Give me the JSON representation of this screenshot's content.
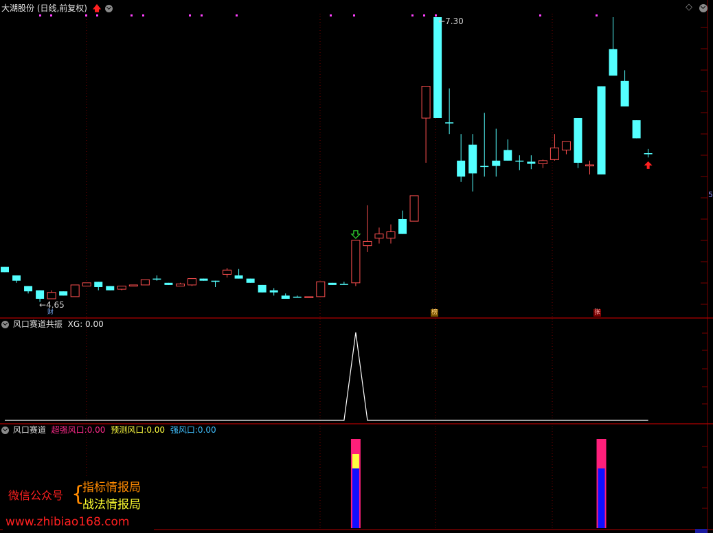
{
  "main": {
    "title": "大湖股份 (日线,前复权)",
    "high_label": "7.30",
    "low_label": "4.65",
    "right_scale_label": "5",
    "markers": {
      "cai": "财",
      "bang": "榜",
      "zhang": "张"
    }
  },
  "xg_panel": {
    "title": "风口赛道共振",
    "value_text": "XG: 0.00"
  },
  "fk_panel": {
    "title": "风口赛道",
    "items": [
      {
        "label": "超强风口:",
        "value": "0.00"
      },
      {
        "label": "预测风口:",
        "value": "0.00"
      },
      {
        "label": "强风口:",
        "value": "0.00"
      }
    ]
  },
  "watermark": {
    "wechat": "微信公众号",
    "line1": "指标情报局",
    "line2": "战法情报局",
    "url": "www.zhibiao168.com"
  },
  "colors": {
    "up": "#ff5050",
    "down": "#54ffff",
    "grid": "#7a0000",
    "xg_line": "#ffffff",
    "super": "#ff1f7a",
    "predict": "#ffff40",
    "strong": "#1010ff"
  },
  "chart_data": [
    {
      "type": "candlestick",
      "x": [
        1,
        2,
        3,
        4,
        5,
        6,
        7,
        8,
        9,
        10,
        11,
        12,
        13,
        14,
        15,
        16,
        17,
        18,
        19,
        20,
        21,
        22,
        23,
        24,
        25,
        26,
        27,
        28,
        29,
        30,
        31,
        32,
        33,
        34,
        35,
        36,
        37,
        38,
        39,
        40,
        41,
        42,
        43,
        44,
        45,
        46,
        47,
        48,
        49,
        50,
        51,
        52,
        53,
        54,
        55,
        56
      ],
      "ohlc": [
        [
          4.95,
          4.95,
          4.9,
          4.9
        ],
        [
          4.87,
          4.87,
          4.8,
          4.82
        ],
        [
          4.77,
          4.77,
          4.7,
          4.72
        ],
        [
          4.73,
          4.73,
          4.62,
          4.65
        ],
        [
          4.65,
          4.73,
          4.65,
          4.71
        ],
        [
          4.72,
          4.72,
          4.68,
          4.68
        ],
        [
          4.67,
          4.78,
          4.67,
          4.78
        ],
        [
          4.77,
          4.8,
          4.77,
          4.8
        ],
        [
          4.81,
          4.81,
          4.73,
          4.76
        ],
        [
          4.77,
          4.77,
          4.73,
          4.73
        ],
        [
          4.74,
          4.77,
          4.73,
          4.77
        ],
        [
          4.77,
          4.78,
          4.77,
          4.78
        ],
        [
          4.78,
          4.83,
          4.78,
          4.83
        ],
        [
          4.84,
          4.87,
          4.82,
          4.84
        ],
        [
          4.8,
          4.8,
          4.78,
          4.78
        ],
        [
          4.77,
          4.8,
          4.77,
          4.79
        ],
        [
          4.78,
          4.84,
          4.77,
          4.84
        ],
        [
          4.84,
          4.84,
          4.82,
          4.82
        ],
        [
          4.82,
          4.82,
          4.76,
          4.81
        ],
        [
          4.88,
          4.94,
          4.85,
          4.92
        ],
        [
          4.87,
          4.93,
          4.84,
          4.84
        ],
        [
          4.84,
          4.84,
          4.8,
          4.8
        ],
        [
          4.78,
          4.78,
          4.71,
          4.71
        ],
        [
          4.73,
          4.75,
          4.68,
          4.71
        ],
        [
          4.68,
          4.7,
          4.65,
          4.65
        ],
        [
          4.67,
          4.68,
          4.66,
          4.66
        ],
        [
          4.66,
          4.67,
          4.66,
          4.67
        ],
        [
          4.67,
          4.81,
          4.67,
          4.81
        ],
        [
          4.8,
          4.8,
          4.78,
          4.78
        ],
        [
          4.79,
          4.81,
          4.79,
          4.79
        ],
        [
          4.8,
          5.2,
          4.77,
          5.2
        ],
        [
          5.15,
          5.53,
          5.09,
          5.19
        ],
        [
          5.22,
          5.32,
          5.17,
          5.26
        ],
        [
          5.22,
          5.35,
          5.17,
          5.28
        ],
        [
          5.4,
          5.48,
          5.26,
          5.26
        ],
        [
          5.38,
          5.62,
          5.38,
          5.62
        ],
        [
          6.35,
          6.6,
          5.93,
          6.65
        ],
        [
          7.3,
          7.3,
          6.35,
          6.35
        ],
        [
          6.31,
          6.63,
          6.2,
          6.31
        ],
        [
          5.95,
          6.2,
          5.75,
          5.8
        ],
        [
          6.1,
          6.2,
          5.66,
          5.83
        ],
        [
          5.9,
          6.4,
          5.8,
          5.9
        ],
        [
          5.95,
          6.25,
          5.8,
          5.9
        ],
        [
          6.05,
          6.15,
          5.95,
          5.95
        ],
        [
          5.95,
          6.0,
          5.86,
          5.95
        ],
        [
          5.94,
          6.0,
          5.87,
          5.92
        ],
        [
          5.92,
          5.96,
          5.88,
          5.95
        ],
        [
          5.96,
          6.2,
          5.95,
          6.07
        ],
        [
          6.05,
          6.11,
          6.01,
          6.13
        ],
        [
          6.35,
          6.35,
          5.88,
          5.93
        ],
        [
          5.9,
          5.95,
          5.82,
          5.91
        ],
        [
          6.65,
          6.65,
          5.82,
          5.82
        ],
        [
          7.0,
          7.3,
          6.75,
          6.75
        ],
        [
          6.7,
          6.8,
          6.46,
          6.46
        ],
        [
          6.33,
          6.33,
          6.16,
          6.16
        ],
        [
          6.02,
          6.06,
          5.98,
          6.02
        ]
      ],
      "last_close_shown": 6.23,
      "annotations": [
        "7.30",
        "4.65"
      ]
    },
    {
      "type": "line",
      "series": [
        {
          "name": "XG",
          "values_note": "0 everywhere, 1 at bar 31"
        }
      ],
      "x": [
        1,
        30,
        31,
        32,
        56
      ],
      "y": [
        0,
        0,
        1,
        0,
        0
      ]
    },
    {
      "type": "bar",
      "series": [
        {
          "name": "超强风口",
          "x": [
            31,
            52
          ],
          "values": [
            1,
            1
          ]
        },
        {
          "name": "预测风口",
          "x": [
            31
          ],
          "values": [
            1
          ]
        },
        {
          "name": "强风口",
          "x": [
            31,
            52
          ],
          "values": [
            1,
            1
          ]
        }
      ]
    }
  ]
}
